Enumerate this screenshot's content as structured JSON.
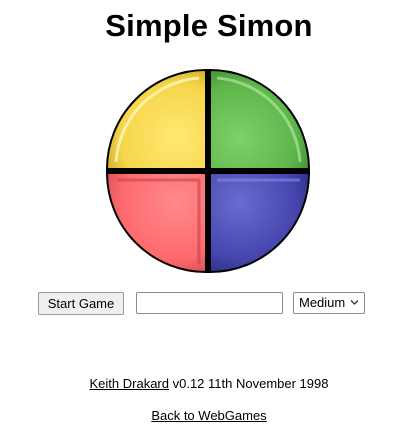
{
  "page": {
    "title": "Simple Simon"
  },
  "board": {
    "quadrants": [
      {
        "name": "yellow",
        "color": "#f5d54a"
      },
      {
        "name": "green",
        "color": "#62b84f"
      },
      {
        "name": "red",
        "color": "#ff6b6e"
      },
      {
        "name": "blue",
        "color": "#4747b0"
      }
    ]
  },
  "controls": {
    "start_label": "Start Game",
    "sequence_value": "",
    "sequence_placeholder": "",
    "difficulty_selected": "Medium"
  },
  "footer": {
    "author_link": "Keith Drakard",
    "version_text": " v0.12 11th November 1998",
    "back_link": "Back to WebGames"
  }
}
